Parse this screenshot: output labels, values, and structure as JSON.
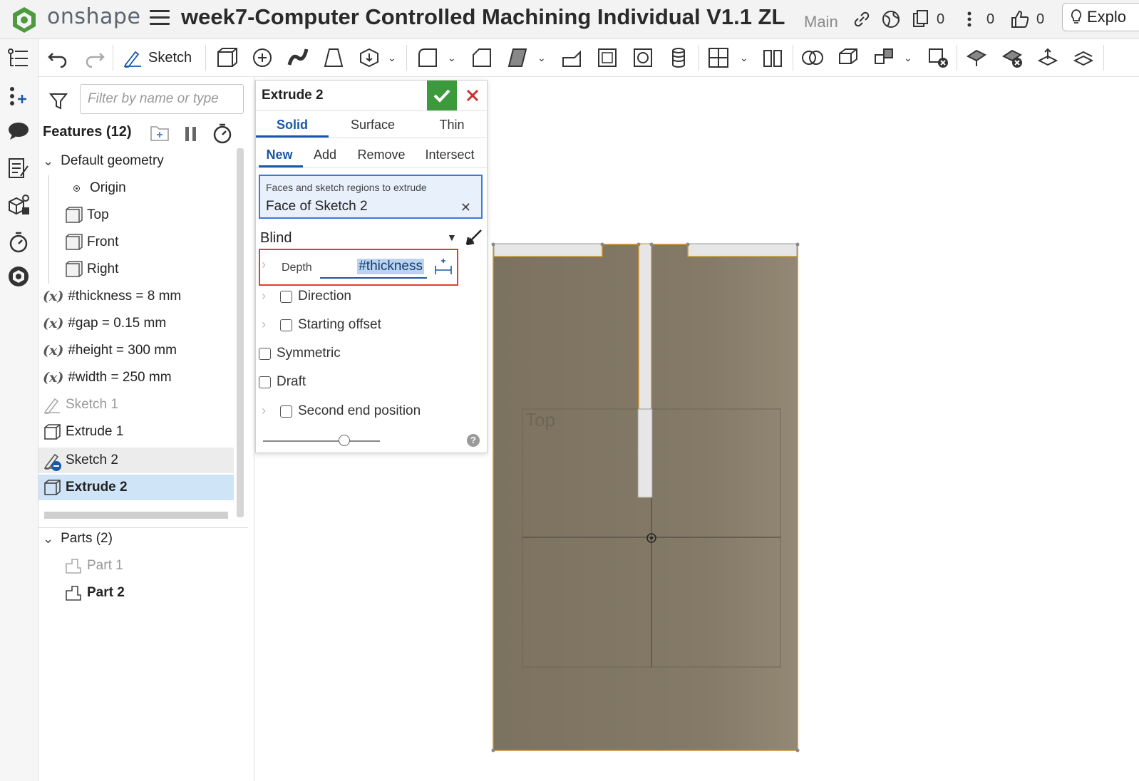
{
  "app": {
    "brand": "onshape",
    "doc_title": "week7-Computer Controlled Machining Individual V1.1 ZL",
    "branch": "Main"
  },
  "topbar": {
    "versions_count": "0",
    "comments_count": "0",
    "likes_count": "0",
    "explore_label": "Explo"
  },
  "toolbar": {
    "sketch_label": "Sketch"
  },
  "feature_panel": {
    "filter_placeholder": "Filter by name or type",
    "features_title": "Features (12)",
    "default_geometry": "Default geometry",
    "items": {
      "origin": "Origin",
      "top": "Top",
      "front": "Front",
      "right": "Right",
      "var_thickness": "#thickness = 8 mm",
      "var_gap": "#gap = 0.15 mm",
      "var_height": "#height = 300 mm",
      "var_width": "#width = 250 mm",
      "sketch1": "Sketch 1",
      "extrude1": "Extrude 1",
      "sketch2": "Sketch 2",
      "extrude2": "Extrude 2"
    },
    "parts_title": "Parts (2)",
    "part1": "Part 1",
    "part2": "Part 2",
    "var_symbol": "(x)"
  },
  "dialog": {
    "title": "Extrude 2",
    "type_tabs": [
      "Solid",
      "Surface",
      "Thin"
    ],
    "op_tabs": [
      "New",
      "Add",
      "Remove",
      "Intersect"
    ],
    "faces_label": "Faces and sketch regions to extrude",
    "faces_value": "Face of Sketch 2",
    "end_type": "Blind",
    "depth_label": "Depth",
    "depth_value": "#thickness",
    "direction": "Direction",
    "starting_offset": "Starting offset",
    "symmetric": "Symmetric",
    "draft": "Draft",
    "second_end": "Second end position"
  },
  "viewport": {
    "plane_label": "Top",
    "part_color": "#847a67"
  }
}
